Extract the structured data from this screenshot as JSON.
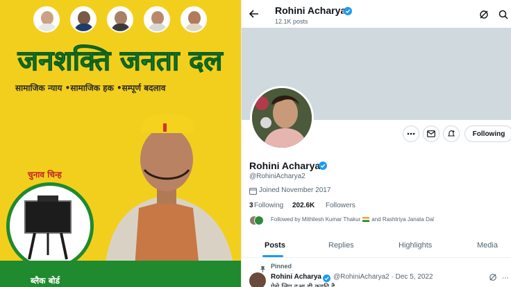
{
  "poster": {
    "party_name": "जनशक्ति जनता दल",
    "slogans": "सामाजिक न्याय •सामाजिक हक •सम्पूर्ण बदलाव",
    "symbol_label": "चुनाव चिन्ह",
    "symbol_caption": "ब्लैक बोर्ड",
    "colors": {
      "background": "#f3cf1d",
      "green": "#1f8a2e",
      "red": "#c0261f"
    }
  },
  "profile": {
    "header": {
      "name": "Rohini Acharya",
      "posts": "12.1K posts"
    },
    "display_name": "Rohini Acharya",
    "handle": "@RohiniAcharya2",
    "joined": "Joined November 2017",
    "following_count": "3",
    "following_label": "Following",
    "followers_count": "202.6K",
    "followers_label": "Followers",
    "followed_by": "Followed by Mithilesh Kumar Thakur",
    "followed_by_rest": "and Rashtriya Janata Dal",
    "following_button": "Following",
    "tabs": [
      {
        "label": "Posts"
      },
      {
        "label": "Replies"
      },
      {
        "label": "Highlights"
      },
      {
        "label": "Media"
      }
    ],
    "pinned_tweet": {
      "pinned_label": "Pinned",
      "name": "Rohini Acharya",
      "handle_date": "@RohiniAcharya2 · Dec 5, 2022",
      "text": "ऐसे लिए दुआ ही काफी है"
    },
    "colors": {
      "accent": "#1d9bf0",
      "text": "#0f1419",
      "muted": "#536471"
    }
  }
}
